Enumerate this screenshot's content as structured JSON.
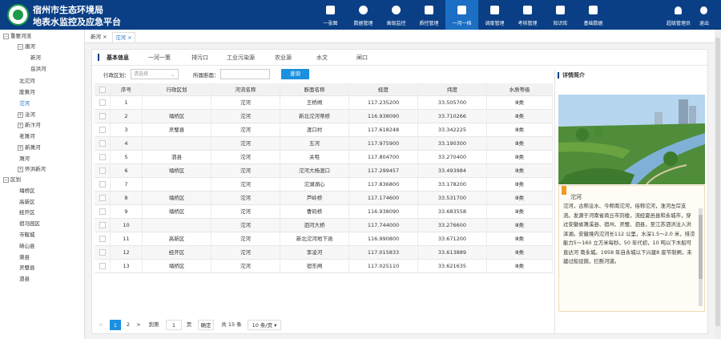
{
  "header": {
    "title_line1": "宿州市生态环境局",
    "title_line2": "地表水监控及应急平台",
    "nav": [
      {
        "label": "一张图",
        "icon": "monitor-icon"
      },
      {
        "label": "数据管理",
        "icon": "database-icon"
      },
      {
        "label": "高级监控",
        "icon": "globe-icon"
      },
      {
        "label": "质控管理",
        "icon": "shield-icon"
      },
      {
        "label": "一河一档",
        "icon": "archive-icon"
      },
      {
        "label": "调度管理",
        "icon": "dispatch-icon"
      },
      {
        "label": "考核管理",
        "icon": "assessment-icon"
      },
      {
        "label": "知识库",
        "icon": "book-icon"
      },
      {
        "label": "基础数据",
        "icon": "base-data-icon"
      }
    ],
    "user_label": "超级管理员",
    "logout_label": "退出"
  },
  "sidebar": {
    "items": [
      {
        "label": "重要河流",
        "toggle": "−"
      },
      {
        "label": "唐河",
        "toggle": "−"
      },
      {
        "label": "新河",
        "toggle": ""
      },
      {
        "label": "岳洪河",
        "toggle": ""
      },
      {
        "label": "北沱河",
        "toggle": ""
      },
      {
        "label": "废黄河",
        "toggle": ""
      },
      {
        "label": "沱河",
        "toggle": ""
      },
      {
        "label": "浍河",
        "toggle": "+"
      },
      {
        "label": "新汴河",
        "toggle": "+"
      },
      {
        "label": "老濉河",
        "toggle": ""
      },
      {
        "label": "新濉河",
        "toggle": "+"
      },
      {
        "label": "濉河",
        "toggle": ""
      },
      {
        "label": "怀洪新河",
        "toggle": "+"
      },
      {
        "label": "区划",
        "toggle": "−"
      },
      {
        "label": "埇桥区",
        "toggle": ""
      },
      {
        "label": "高新区",
        "toggle": ""
      },
      {
        "label": "经开区",
        "toggle": ""
      },
      {
        "label": "宿马园区",
        "toggle": ""
      },
      {
        "label": "市鞍城",
        "toggle": ""
      },
      {
        "label": "砀山县",
        "toggle": ""
      },
      {
        "label": "萧县",
        "toggle": ""
      },
      {
        "label": "灵璧县",
        "toggle": ""
      },
      {
        "label": "泗县",
        "toggle": ""
      }
    ]
  },
  "tabs": [
    {
      "label": "新河 ×"
    },
    {
      "label": "沱河 ×"
    }
  ],
  "subtabs": [
    "基本信息",
    "一河一策",
    "排污口",
    "工业污染源",
    "农业源",
    "水文",
    "闸口"
  ],
  "filter": {
    "district_label": "行政区划：",
    "district_placeholder": "请选择",
    "section_label": "所属断面：",
    "query_label": "查询"
  },
  "table": {
    "headers": [
      "序号",
      "行政区划",
      "河流名称",
      "断面名称",
      "经度",
      "纬度",
      "水质等级"
    ],
    "rows": [
      [
        "1",
        "",
        "沱河",
        "王桥闸",
        "117.235200",
        "33.505700",
        "Ⅲ类"
      ],
      [
        "2",
        "埇桥区",
        "沱河",
        "新北沱河蒂桥",
        "116.938090",
        "33.710266",
        "Ⅲ类"
      ],
      [
        "3",
        "灵璧县",
        "沱河",
        "渡口村",
        "117.618248",
        "33.342225",
        "Ⅲ类"
      ],
      [
        "4",
        "",
        "沱河",
        "五河",
        "117.975900",
        "33.190300",
        "Ⅲ类"
      ],
      [
        "5",
        "泗县",
        "沱河",
        "关咀",
        "117.804700",
        "33.270400",
        "Ⅲ类"
      ],
      [
        "6",
        "埇桥区",
        "沱河",
        "沱河大杨渡口",
        "117.299457",
        "33.493984",
        "Ⅲ类"
      ],
      [
        "7",
        "",
        "沱河",
        "沱湖湖心",
        "117.836800",
        "33.178200",
        "Ⅲ类"
      ],
      [
        "8",
        "埇桥区",
        "沱河",
        "芦岭桥",
        "117.174600",
        "33.531700",
        "Ⅲ类"
      ],
      [
        "9",
        "埇桥区",
        "沱河",
        "曹码桥",
        "116.938090",
        "33.683558",
        "Ⅲ类"
      ],
      [
        "10",
        "",
        "沱河",
        "泗河大桥",
        "117.744000",
        "33.276600",
        "Ⅲ类"
      ],
      [
        "11",
        "高新区",
        "沱河",
        "新北沱河地下涵",
        "116.990800",
        "33.671200",
        "Ⅲ类"
      ],
      [
        "12",
        "经开区",
        "沱河",
        "李凌河",
        "117.015833",
        "33.613889",
        "Ⅲ类"
      ],
      [
        "13",
        "埇桥区",
        "沱河",
        "宿东闸",
        "117.025110",
        "33.621635",
        "Ⅲ类"
      ]
    ]
  },
  "pager": {
    "prev": "<",
    "pages": [
      "1",
      "2"
    ],
    "next": ">",
    "goto_label": "到第",
    "goto_value": "1",
    "page_unit": "页",
    "confirm": "确定",
    "total": "共 15 条",
    "per_page": "10 条/页"
  },
  "detail": {
    "title": "详情简介",
    "river_name": "沱河",
    "description": "沱河，古称浍水、今称南沱河，俗称沱河，淮河左岸支流。发源于河南省商丘市刘楼，流经夏邑县和永城市，穿过安徽省濉溪县、宿州、灵璧、泗县，至江苏泗洪注入洪泽湖。安徽境内沱河长112 公里，水深1.5～2.0 米，排涝能力5～160 立方米每秒。50 年代初，10 吨以下木船可直达河 南永城。1958 年自永城以下兴建8 座节制闸，未建过船设施，拦断河道。"
  }
}
